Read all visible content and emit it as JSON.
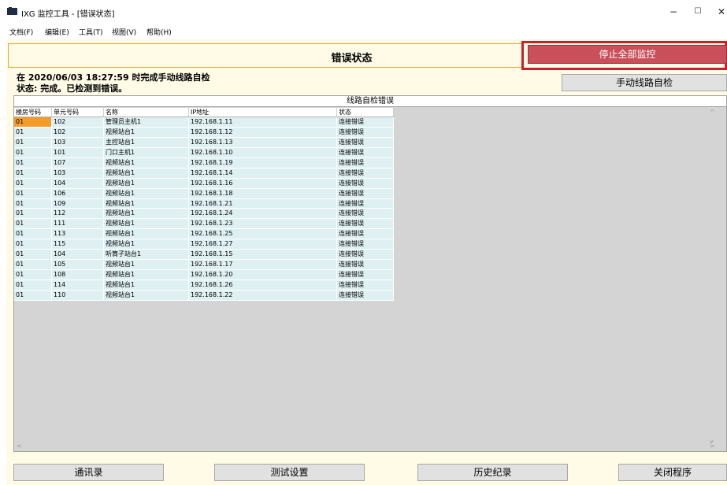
{
  "window": {
    "title": "IXG 监控工具 - [错误状态]",
    "minimize": "−",
    "maximize": "☐",
    "close": "✕"
  },
  "menu": [
    "文档(F)",
    "编辑(E)",
    "工具(T)",
    "视图(V)",
    "帮助(H)"
  ],
  "header": {
    "title": "错误状态",
    "stop_all_label": "停止全部监控"
  },
  "status": {
    "line1": "在 2020/06/03 18:27:59 时完成手动线路自检",
    "line2": "状态: 完成。已检测到错误。"
  },
  "manual_check_label": "手动线路自检",
  "table": {
    "caption": "线路自检错误",
    "columns": [
      "楼房号码",
      "单元号码",
      "名称",
      "IP地址",
      "状态"
    ],
    "rows": [
      [
        "01",
        "102",
        "管理员主机1",
        "192.168.1.11",
        "连接错误"
      ],
      [
        "01",
        "102",
        "视频站台1",
        "192.168.1.12",
        "连接错误"
      ],
      [
        "01",
        "103",
        "主控站台1",
        "192.168.1.13",
        "连接错误"
      ],
      [
        "01",
        "101",
        "门口主机1",
        "192.168.1.10",
        "连接错误"
      ],
      [
        "01",
        "107",
        "视频站台1",
        "192.168.1.19",
        "连接错误"
      ],
      [
        "01",
        "103",
        "视频站台1",
        "192.168.1.14",
        "连接错误"
      ],
      [
        "01",
        "104",
        "视频站台1",
        "192.168.1.16",
        "连接错误"
      ],
      [
        "01",
        "106",
        "视频站台1",
        "192.168.1.18",
        "连接错误"
      ],
      [
        "01",
        "109",
        "视频站台1",
        "192.168.1.21",
        "连接错误"
      ],
      [
        "01",
        "112",
        "视频站台1",
        "192.168.1.24",
        "连接错误"
      ],
      [
        "01",
        "111",
        "视频站台1",
        "192.168.1.23",
        "连接错误"
      ],
      [
        "01",
        "113",
        "视频站台1",
        "192.168.1.25",
        "连接错误"
      ],
      [
        "01",
        "115",
        "视频站台1",
        "192.168.1.27",
        "连接错误"
      ],
      [
        "01",
        "104",
        "听筒子站台1",
        "192.168.1.15",
        "连接错误"
      ],
      [
        "01",
        "105",
        "视频站台1",
        "192.168.1.17",
        "连接错误"
      ],
      [
        "01",
        "108",
        "视频站台1",
        "192.168.1.20",
        "连接错误"
      ],
      [
        "01",
        "114",
        "视频站台1",
        "192.168.1.26",
        "连接错误"
      ],
      [
        "01",
        "110",
        "视频站台1",
        "192.168.1.22",
        "连接错误"
      ]
    ]
  },
  "footer": {
    "comm_log": "通讯录",
    "test_settings": "测试设置",
    "history": "历史纪录",
    "close_program": "关闭程序"
  },
  "colors": {
    "accent_red": "#c9505a",
    "highlight_outline": "#c8202a",
    "row_bg": "#dff0f3",
    "selected_cell": "#f39c2a"
  }
}
